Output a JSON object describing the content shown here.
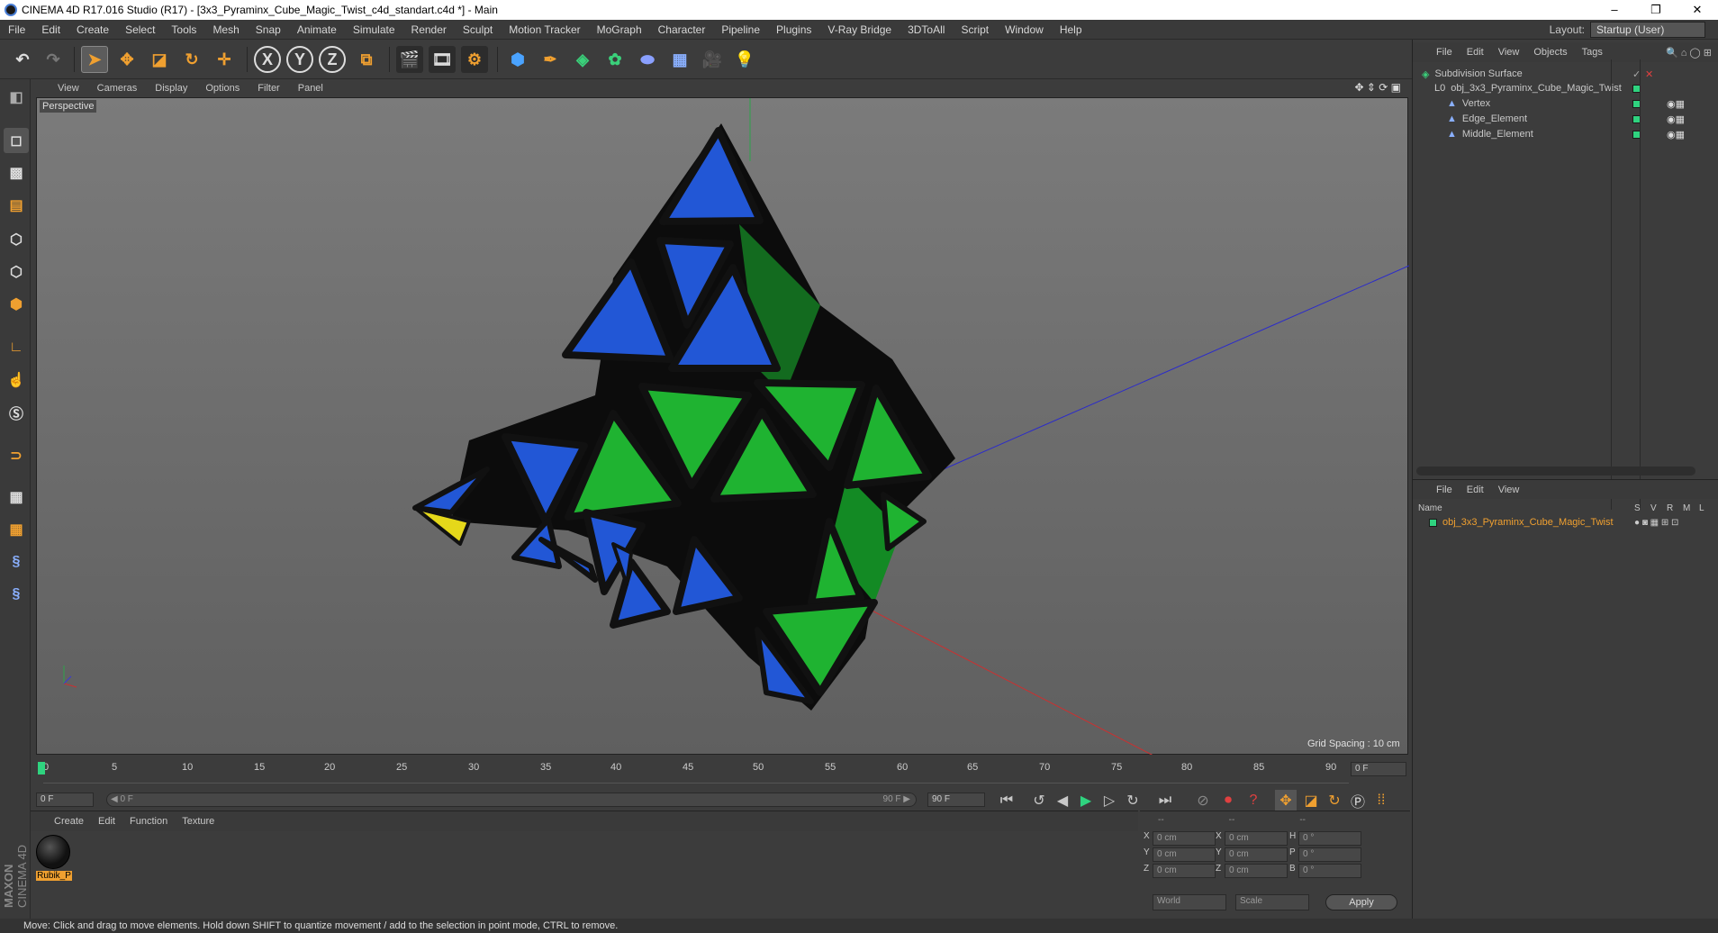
{
  "window": {
    "title": "CINEMA 4D R17.016 Studio (R17) - [3x3_Pyraminx_Cube_Magic_Twist_c4d_standart.c4d *] - Main",
    "controls": [
      "–",
      "❐",
      "✕"
    ]
  },
  "menubar": {
    "items": [
      "File",
      "Edit",
      "Create",
      "Select",
      "Tools",
      "Mesh",
      "Snap",
      "Animate",
      "Simulate",
      "Render",
      "Sculpt",
      "Motion Tracker",
      "MoGraph",
      "Character",
      "Pipeline",
      "Plugins",
      "V-Ray Bridge",
      "3DToAll",
      "Script",
      "Window",
      "Help"
    ],
    "layout_label": "Layout:",
    "layout_value": "Startup (User)"
  },
  "toolbar": {
    "icons": [
      "undo-icon",
      "redo-icon",
      "select-arrow-icon",
      "move-icon",
      "scale-icon",
      "rotate-icon",
      "move-axis-icon",
      "x-axis-icon",
      "y-axis-icon",
      "z-axis-icon",
      "coordinate-system-icon",
      "render-view-icon",
      "render-picture-viewer-icon",
      "edit-render-settings-icon",
      "cube-icon",
      "pen-spline-icon",
      "subdivision-icon",
      "mograph-cloner-icon",
      "deformer-icon",
      "floor-icon",
      "camera-icon",
      "light-icon"
    ],
    "axis_labels": {
      "x": "X",
      "y": "Y",
      "z": "Z"
    }
  },
  "viewport": {
    "menu": [
      "View",
      "Cameras",
      "Display",
      "Options",
      "Filter",
      "Panel"
    ],
    "label": "Perspective",
    "grid_spacing": "Grid Spacing : 10 cm"
  },
  "object_manager": {
    "menu": [
      "File",
      "Edit",
      "View",
      "Objects",
      "Tags"
    ],
    "objects": [
      {
        "name": "Subdivision Surface",
        "indent": 0
      },
      {
        "name": "obj_3x3_Pyraminx_Cube_Magic_Twist",
        "indent": 1
      },
      {
        "name": "Vertex",
        "indent": 2
      },
      {
        "name": "Edge_Element",
        "indent": 2
      },
      {
        "name": "Middle_Element",
        "indent": 2
      }
    ]
  },
  "layer_manager": {
    "menu": [
      "File",
      "Edit",
      "View"
    ],
    "columns": [
      "Name",
      "S",
      "V",
      "R",
      "M",
      "L"
    ],
    "rows": [
      {
        "name": "obj_3x3_Pyraminx_Cube_Magic_Twist"
      }
    ]
  },
  "timeline": {
    "ticks": [
      "0",
      "5",
      "10",
      "15",
      "20",
      "25",
      "30",
      "35",
      "40",
      "45",
      "50",
      "55",
      "60",
      "65",
      "70",
      "75",
      "80",
      "85",
      "90"
    ],
    "current_frame_right": "0 F",
    "start_field": "0 F",
    "range_start": "◀ 0 F",
    "range_end": "90 F ▶",
    "end_field": "90 F"
  },
  "material_manager": {
    "menu": [
      "Create",
      "Edit",
      "Function",
      "Texture"
    ],
    "materials": [
      {
        "name": "Rubik_P"
      }
    ]
  },
  "attributes": {
    "header": [
      "--",
      "--",
      "--"
    ],
    "rows": [
      {
        "a": "X",
        "av": "0 cm",
        "b": "X",
        "bv": "0 cm",
        "c": "H",
        "cv": "0 °"
      },
      {
        "a": "Y",
        "av": "0 cm",
        "b": "Y",
        "bv": "0 cm",
        "c": "P",
        "cv": "0 °"
      },
      {
        "a": "Z",
        "av": "0 cm",
        "b": "Z",
        "bv": "0 cm",
        "c": "B",
        "cv": "0 °"
      }
    ],
    "world_dropdown": "World",
    "scale_dropdown": "Scale",
    "apply_label": "Apply"
  },
  "statusbar": {
    "text": "Move: Click and drag to move elements. Hold down SHIFT to quantize movement / add to the selection in point mode, CTRL to remove."
  },
  "brand": {
    "maxon": "MAXON",
    "cinema": "CINEMA 4D"
  },
  "colors": {
    "blue_face": "#2257d6",
    "green_face": "#1fb331",
    "yellow_face": "#e5d81a",
    "accent_orange": "#f0a030",
    "object_green": "#2fd37f"
  }
}
